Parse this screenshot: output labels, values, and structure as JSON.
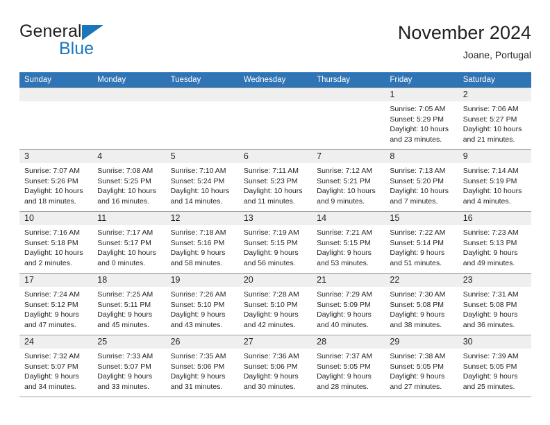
{
  "brand": {
    "name_dark": "General",
    "name_blue": "Blue",
    "triangle_icon": "triangle-icon",
    "accent_color": "#1b75bb"
  },
  "header": {
    "title": "November 2024",
    "subtitle": "Joane, Portugal"
  },
  "theme": {
    "header_blue": "#2f74b5",
    "daynum_bg": "#efefef",
    "grid_line": "#9f9f9f",
    "text": "#231f20"
  },
  "calendar": {
    "weekday_headers": [
      "Sunday",
      "Monday",
      "Tuesday",
      "Wednesday",
      "Thursday",
      "Friday",
      "Saturday"
    ],
    "weeks": [
      [
        {
          "day": "",
          "blank": true,
          "sunrise": "",
          "sunset": "",
          "daylight1": "",
          "daylight2": ""
        },
        {
          "day": "",
          "blank": true,
          "sunrise": "",
          "sunset": "",
          "daylight1": "",
          "daylight2": ""
        },
        {
          "day": "",
          "blank": true,
          "sunrise": "",
          "sunset": "",
          "daylight1": "",
          "daylight2": ""
        },
        {
          "day": "",
          "blank": true,
          "sunrise": "",
          "sunset": "",
          "daylight1": "",
          "daylight2": ""
        },
        {
          "day": "",
          "blank": true,
          "sunrise": "",
          "sunset": "",
          "daylight1": "",
          "daylight2": ""
        },
        {
          "day": "1",
          "blank": false,
          "sunrise": "Sunrise: 7:05 AM",
          "sunset": "Sunset: 5:29 PM",
          "daylight1": "Daylight: 10 hours",
          "daylight2": "and 23 minutes."
        },
        {
          "day": "2",
          "blank": false,
          "sunrise": "Sunrise: 7:06 AM",
          "sunset": "Sunset: 5:27 PM",
          "daylight1": "Daylight: 10 hours",
          "daylight2": "and 21 minutes."
        }
      ],
      [
        {
          "day": "3",
          "blank": false,
          "sunrise": "Sunrise: 7:07 AM",
          "sunset": "Sunset: 5:26 PM",
          "daylight1": "Daylight: 10 hours",
          "daylight2": "and 18 minutes."
        },
        {
          "day": "4",
          "blank": false,
          "sunrise": "Sunrise: 7:08 AM",
          "sunset": "Sunset: 5:25 PM",
          "daylight1": "Daylight: 10 hours",
          "daylight2": "and 16 minutes."
        },
        {
          "day": "5",
          "blank": false,
          "sunrise": "Sunrise: 7:10 AM",
          "sunset": "Sunset: 5:24 PM",
          "daylight1": "Daylight: 10 hours",
          "daylight2": "and 14 minutes."
        },
        {
          "day": "6",
          "blank": false,
          "sunrise": "Sunrise: 7:11 AM",
          "sunset": "Sunset: 5:23 PM",
          "daylight1": "Daylight: 10 hours",
          "daylight2": "and 11 minutes."
        },
        {
          "day": "7",
          "blank": false,
          "sunrise": "Sunrise: 7:12 AM",
          "sunset": "Sunset: 5:21 PM",
          "daylight1": "Daylight: 10 hours",
          "daylight2": "and 9 minutes."
        },
        {
          "day": "8",
          "blank": false,
          "sunrise": "Sunrise: 7:13 AM",
          "sunset": "Sunset: 5:20 PM",
          "daylight1": "Daylight: 10 hours",
          "daylight2": "and 7 minutes."
        },
        {
          "day": "9",
          "blank": false,
          "sunrise": "Sunrise: 7:14 AM",
          "sunset": "Sunset: 5:19 PM",
          "daylight1": "Daylight: 10 hours",
          "daylight2": "and 4 minutes."
        }
      ],
      [
        {
          "day": "10",
          "blank": false,
          "sunrise": "Sunrise: 7:16 AM",
          "sunset": "Sunset: 5:18 PM",
          "daylight1": "Daylight: 10 hours",
          "daylight2": "and 2 minutes."
        },
        {
          "day": "11",
          "blank": false,
          "sunrise": "Sunrise: 7:17 AM",
          "sunset": "Sunset: 5:17 PM",
          "daylight1": "Daylight: 10 hours",
          "daylight2": "and 0 minutes."
        },
        {
          "day": "12",
          "blank": false,
          "sunrise": "Sunrise: 7:18 AM",
          "sunset": "Sunset: 5:16 PM",
          "daylight1": "Daylight: 9 hours",
          "daylight2": "and 58 minutes."
        },
        {
          "day": "13",
          "blank": false,
          "sunrise": "Sunrise: 7:19 AM",
          "sunset": "Sunset: 5:15 PM",
          "daylight1": "Daylight: 9 hours",
          "daylight2": "and 56 minutes."
        },
        {
          "day": "14",
          "blank": false,
          "sunrise": "Sunrise: 7:21 AM",
          "sunset": "Sunset: 5:15 PM",
          "daylight1": "Daylight: 9 hours",
          "daylight2": "and 53 minutes."
        },
        {
          "day": "15",
          "blank": false,
          "sunrise": "Sunrise: 7:22 AM",
          "sunset": "Sunset: 5:14 PM",
          "daylight1": "Daylight: 9 hours",
          "daylight2": "and 51 minutes."
        },
        {
          "day": "16",
          "blank": false,
          "sunrise": "Sunrise: 7:23 AM",
          "sunset": "Sunset: 5:13 PM",
          "daylight1": "Daylight: 9 hours",
          "daylight2": "and 49 minutes."
        }
      ],
      [
        {
          "day": "17",
          "blank": false,
          "sunrise": "Sunrise: 7:24 AM",
          "sunset": "Sunset: 5:12 PM",
          "daylight1": "Daylight: 9 hours",
          "daylight2": "and 47 minutes."
        },
        {
          "day": "18",
          "blank": false,
          "sunrise": "Sunrise: 7:25 AM",
          "sunset": "Sunset: 5:11 PM",
          "daylight1": "Daylight: 9 hours",
          "daylight2": "and 45 minutes."
        },
        {
          "day": "19",
          "blank": false,
          "sunrise": "Sunrise: 7:26 AM",
          "sunset": "Sunset: 5:10 PM",
          "daylight1": "Daylight: 9 hours",
          "daylight2": "and 43 minutes."
        },
        {
          "day": "20",
          "blank": false,
          "sunrise": "Sunrise: 7:28 AM",
          "sunset": "Sunset: 5:10 PM",
          "daylight1": "Daylight: 9 hours",
          "daylight2": "and 42 minutes."
        },
        {
          "day": "21",
          "blank": false,
          "sunrise": "Sunrise: 7:29 AM",
          "sunset": "Sunset: 5:09 PM",
          "daylight1": "Daylight: 9 hours",
          "daylight2": "and 40 minutes."
        },
        {
          "day": "22",
          "blank": false,
          "sunrise": "Sunrise: 7:30 AM",
          "sunset": "Sunset: 5:08 PM",
          "daylight1": "Daylight: 9 hours",
          "daylight2": "and 38 minutes."
        },
        {
          "day": "23",
          "blank": false,
          "sunrise": "Sunrise: 7:31 AM",
          "sunset": "Sunset: 5:08 PM",
          "daylight1": "Daylight: 9 hours",
          "daylight2": "and 36 minutes."
        }
      ],
      [
        {
          "day": "24",
          "blank": false,
          "sunrise": "Sunrise: 7:32 AM",
          "sunset": "Sunset: 5:07 PM",
          "daylight1": "Daylight: 9 hours",
          "daylight2": "and 34 minutes."
        },
        {
          "day": "25",
          "blank": false,
          "sunrise": "Sunrise: 7:33 AM",
          "sunset": "Sunset: 5:07 PM",
          "daylight1": "Daylight: 9 hours",
          "daylight2": "and 33 minutes."
        },
        {
          "day": "26",
          "blank": false,
          "sunrise": "Sunrise: 7:35 AM",
          "sunset": "Sunset: 5:06 PM",
          "daylight1": "Daylight: 9 hours",
          "daylight2": "and 31 minutes."
        },
        {
          "day": "27",
          "blank": false,
          "sunrise": "Sunrise: 7:36 AM",
          "sunset": "Sunset: 5:06 PM",
          "daylight1": "Daylight: 9 hours",
          "daylight2": "and 30 minutes."
        },
        {
          "day": "28",
          "blank": false,
          "sunrise": "Sunrise: 7:37 AM",
          "sunset": "Sunset: 5:05 PM",
          "daylight1": "Daylight: 9 hours",
          "daylight2": "and 28 minutes."
        },
        {
          "day": "29",
          "blank": false,
          "sunrise": "Sunrise: 7:38 AM",
          "sunset": "Sunset: 5:05 PM",
          "daylight1": "Daylight: 9 hours",
          "daylight2": "and 27 minutes."
        },
        {
          "day": "30",
          "blank": false,
          "sunrise": "Sunrise: 7:39 AM",
          "sunset": "Sunset: 5:05 PM",
          "daylight1": "Daylight: 9 hours",
          "daylight2": "and 25 minutes."
        }
      ]
    ]
  }
}
